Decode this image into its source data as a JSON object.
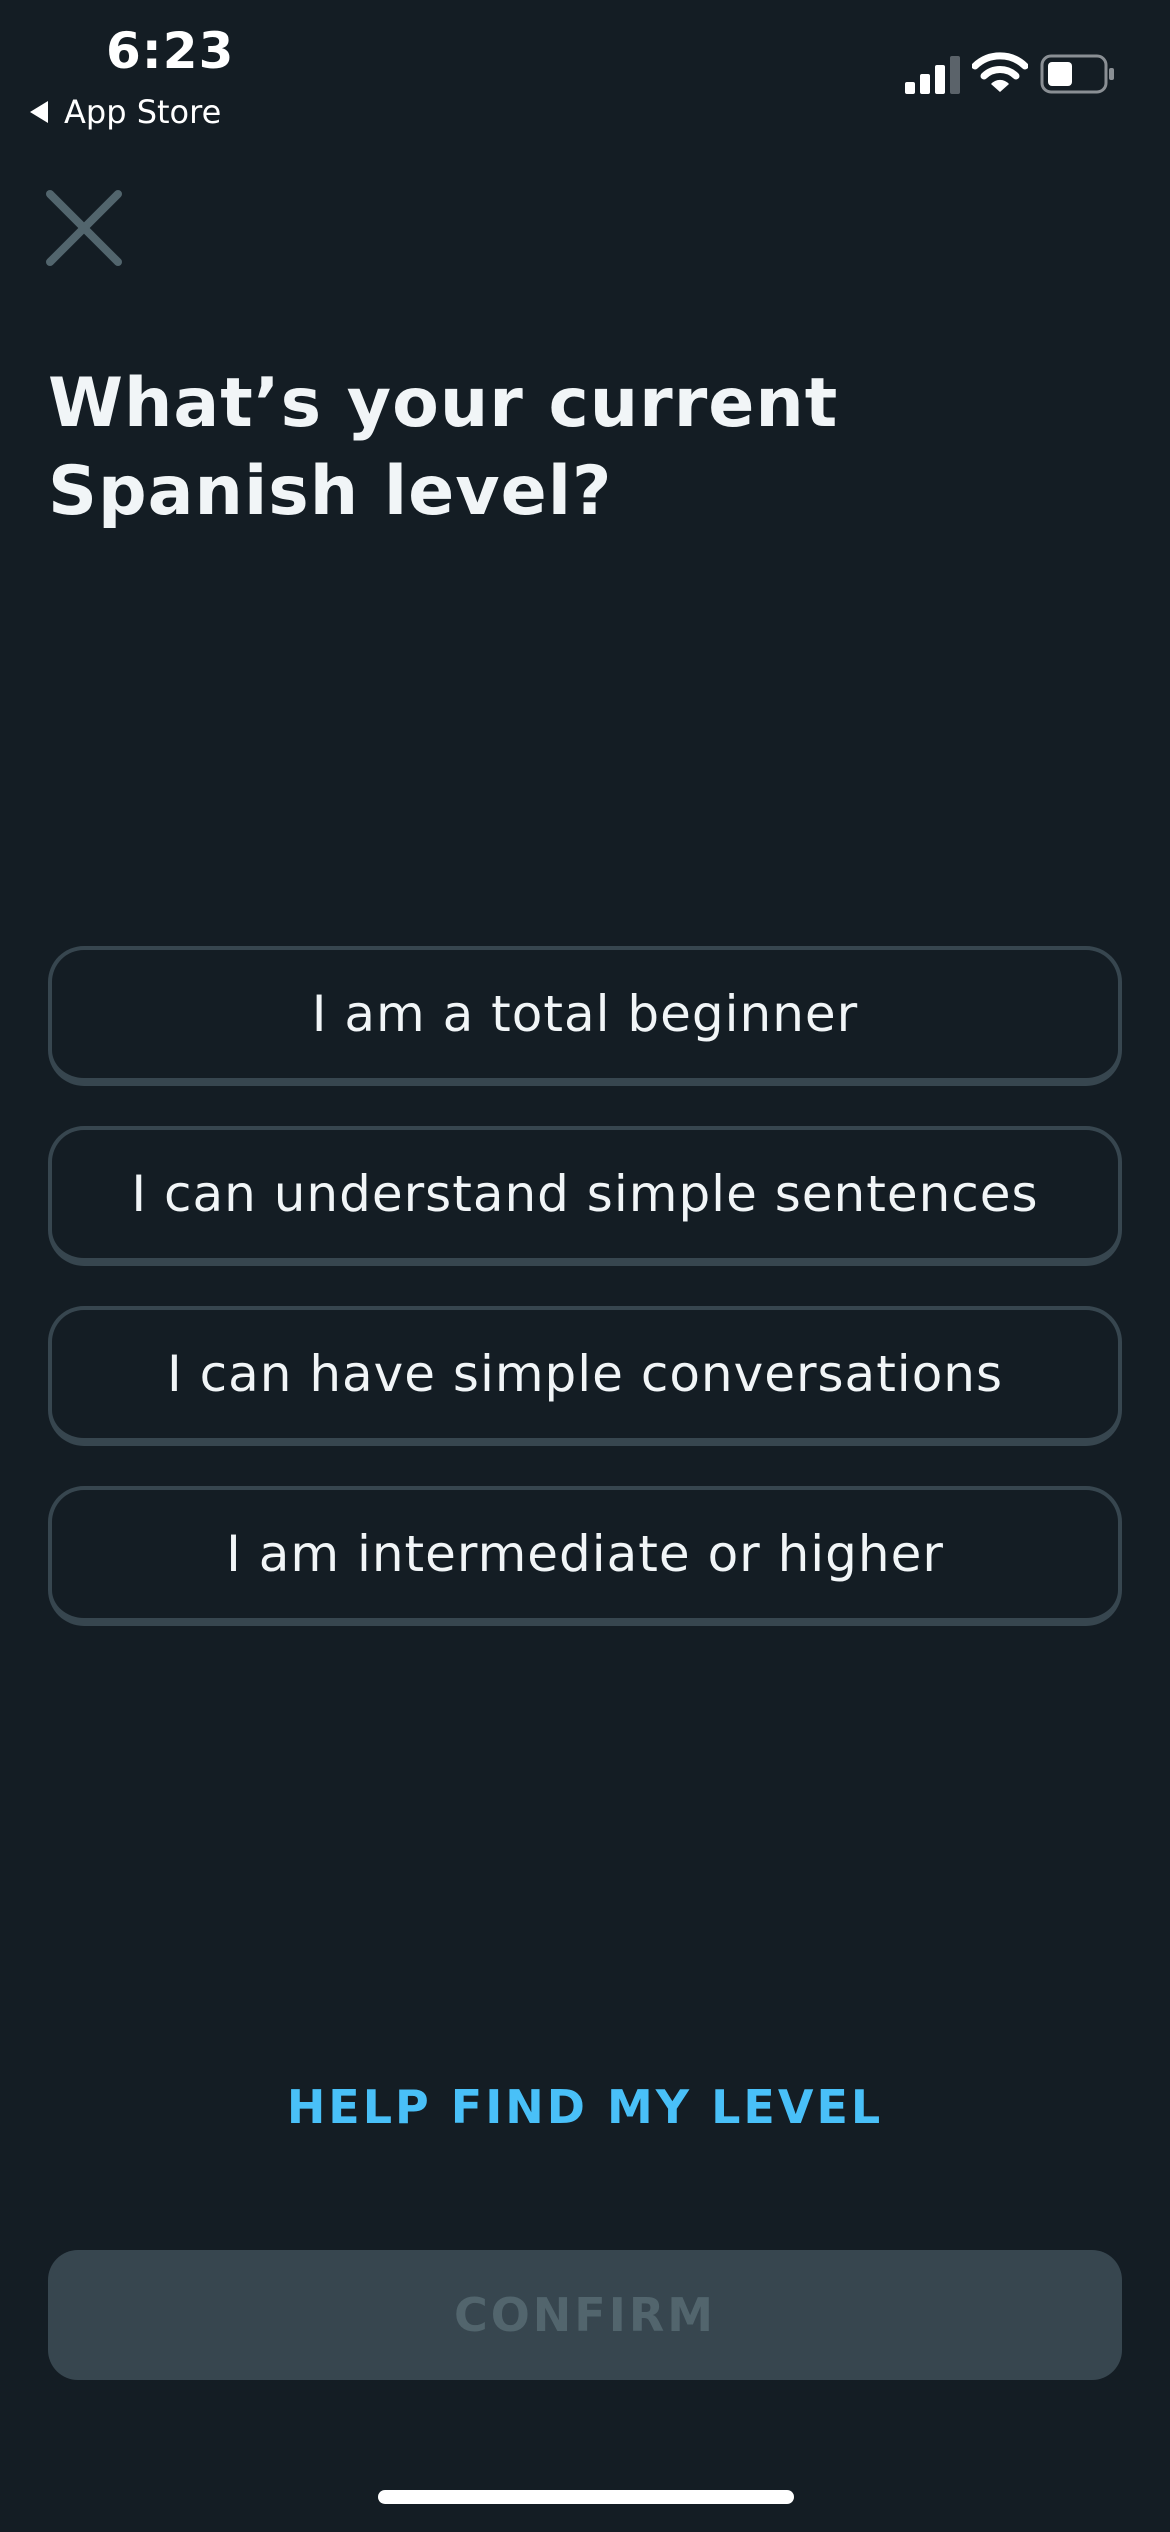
{
  "status_bar": {
    "time": "6:23",
    "back_label": "App Store"
  },
  "title": "What’s your current\nSpanish level?",
  "options": [
    {
      "label": "I am a total beginner"
    },
    {
      "label": "I can understand simple sentences"
    },
    {
      "label": "I can have simple conversations"
    },
    {
      "label": "I am intermediate or higher"
    }
  ],
  "help_link": "HELP FIND MY LEVEL",
  "confirm_label": "CONFIRM",
  "colors": {
    "background": "#141d24",
    "option_border": "#37464f",
    "link": "#49c0f8",
    "disabled_button": "#37464f",
    "disabled_text": "#52656d"
  },
  "icons": {
    "close": "close-icon",
    "back": "back-arrow-icon",
    "signal": "cellular-signal-icon",
    "wifi": "wifi-icon",
    "battery": "battery-icon"
  }
}
